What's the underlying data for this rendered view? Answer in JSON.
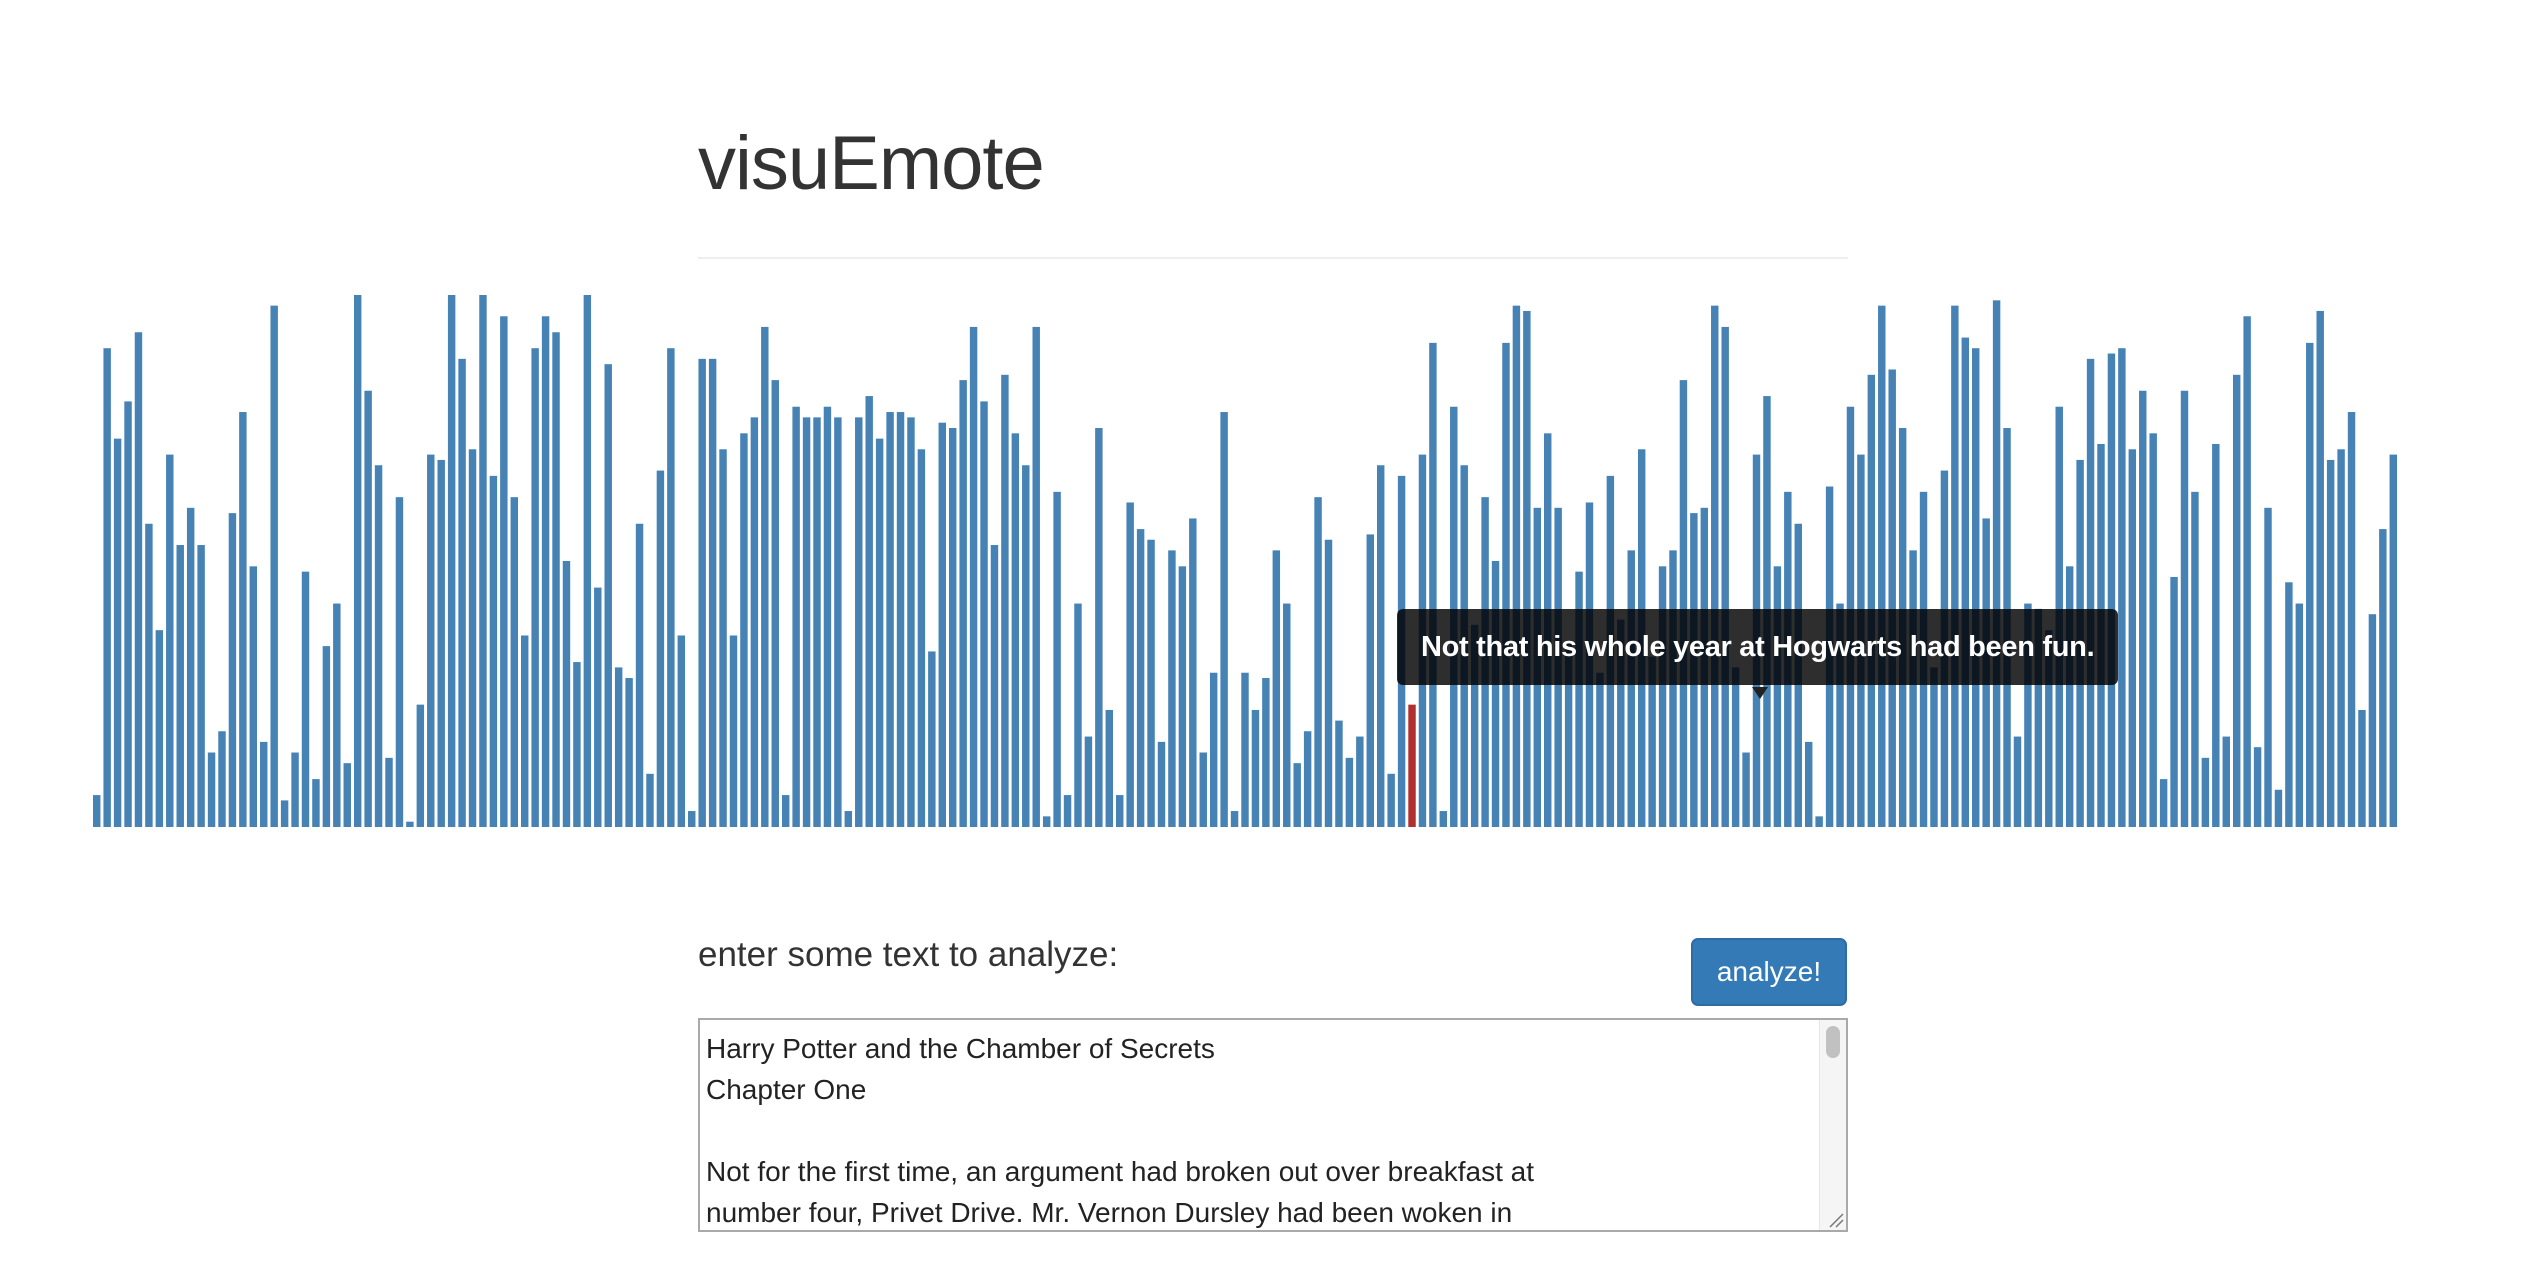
{
  "app": {
    "title": "visuEmote"
  },
  "tooltip": {
    "text": "Not that his whole year at Hogwarts had been fun."
  },
  "input": {
    "label": "enter some text to analyze:",
    "button_label": "analyze!",
    "text_lines": [
      "Harry Potter and the Chamber of Secrets",
      "Chapter One",
      "",
      "Not for the first time, an argument had broken out over breakfast at",
      "number four, Privet Drive. Mr. Vernon Dursley had been woken in"
    ]
  },
  "colors": {
    "bar": "#4682b4",
    "highlight": "#b03030",
    "button": "#337ab7"
  },
  "chart_data": {
    "type": "bar",
    "title": "",
    "xlabel": "",
    "ylabel": "",
    "ylim": [
      0,
      1
    ],
    "highlight_index": 126,
    "values": [
      0.06,
      0.9,
      0.73,
      0.8,
      0.93,
      0.57,
      0.37,
      0.7,
      0.53,
      0.6,
      0.53,
      0.14,
      0.18,
      0.59,
      0.78,
      0.49,
      0.16,
      0.98,
      0.05,
      0.14,
      0.48,
      0.09,
      0.34,
      0.42,
      0.12,
      1.0,
      0.82,
      0.68,
      0.13,
      0.62,
      0.01,
      0.23,
      0.7,
      0.69,
      1.0,
      0.88,
      0.71,
      1.0,
      0.66,
      0.96,
      0.62,
      0.36,
      0.9,
      0.96,
      0.93,
      0.5,
      0.31,
      1.0,
      0.45,
      0.87,
      0.3,
      0.28,
      0.57,
      0.1,
      0.67,
      0.9,
      0.36,
      0.03,
      0.88,
      0.88,
      0.71,
      0.36,
      0.74,
      0.77,
      0.94,
      0.84,
      0.06,
      0.79,
      0.77,
      0.77,
      0.79,
      0.77,
      0.03,
      0.77,
      0.81,
      0.73,
      0.78,
      0.78,
      0.77,
      0.71,
      0.33,
      0.76,
      0.75,
      0.84,
      0.94,
      0.8,
      0.53,
      0.85,
      0.74,
      0.68,
      0.94,
      0.02,
      0.63,
      0.06,
      0.42,
      0.17,
      0.75,
      0.22,
      0.06,
      0.61,
      0.56,
      0.54,
      0.16,
      0.52,
      0.49,
      0.58,
      0.14,
      0.29,
      0.78,
      0.03,
      0.29,
      0.22,
      0.28,
      0.52,
      0.42,
      0.12,
      0.18,
      0.62,
      0.54,
      0.2,
      0.13,
      0.17,
      0.55,
      0.68,
      0.1,
      0.66,
      0.23,
      0.7,
      0.91,
      0.03,
      0.79,
      0.68,
      0.38,
      0.62,
      0.5,
      0.91,
      0.98,
      0.97,
      0.6,
      0.74,
      0.6,
      0.35,
      0.48,
      0.61,
      0.29,
      0.66,
      0.39,
      0.52,
      0.71,
      0.32,
      0.49,
      0.52,
      0.84,
      0.59,
      0.6,
      0.98,
      0.94,
      0.3,
      0.14,
      0.7,
      0.81,
      0.49,
      0.63,
      0.57,
      0.16,
      0.02,
      0.64,
      0.42,
      0.79,
      0.7,
      0.85,
      0.98,
      0.86,
      0.75,
      0.52,
      0.63,
      0.3,
      0.67,
      0.98,
      0.92,
      0.9,
      0.58,
      0.99,
      0.75,
      0.17,
      0.42,
      0.41,
      0.37,
      0.79,
      0.49,
      0.69,
      0.88,
      0.72,
      0.89,
      0.9,
      0.71,
      0.82,
      0.74,
      0.09,
      0.47,
      0.82,
      0.63,
      0.13,
      0.72,
      0.17,
      0.85,
      0.96,
      0.15,
      0.6,
      0.07,
      0.46,
      0.42,
      0.91,
      0.97,
      0.69,
      0.71,
      0.78,
      0.22,
      0.4,
      0.56,
      0.7
    ]
  }
}
